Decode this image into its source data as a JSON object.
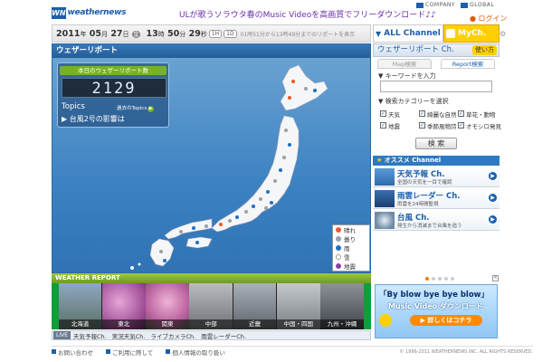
{
  "header": {
    "logo_mark": "WN",
    "logo_text": "weathernews",
    "promo": "ULが歌うソラウタ春のMusic Videoを高画質でフリーダウンロード♪♪",
    "links": [
      "COMPANY",
      "GLOBAL"
    ],
    "login": "ログイン"
  },
  "datebar": {
    "year": "2011",
    "y_unit": "年",
    "month": "05",
    "m_unit": "月",
    "day": "27",
    "d_unit": "日",
    "weekday": "金",
    "hour": "13",
    "h_unit": "時",
    "minute": "50",
    "min_unit": "分",
    "second": "29",
    "s_unit": "秒",
    "btn1": "1H",
    "btn2": "1D",
    "range_note": "01時51分から13時49分までのリポートを表示"
  },
  "channels": {
    "all": "ALL Channel",
    "my": "MyCh."
  },
  "map": {
    "title": "ウェザーリポート",
    "counter_label": "本日のウェザーリポート数",
    "count": "2129",
    "topics": "Topics",
    "past_topics": "過去のTopics",
    "topic_line": "台風2号の影響は",
    "legend": [
      {
        "label": "晴れ",
        "color": "#f05a28"
      },
      {
        "label": "曇り",
        "color": "#9aa0a6"
      },
      {
        "label": "雨",
        "color": "#1f6fc4"
      },
      {
        "label": "雪",
        "color": "#ffffff"
      },
      {
        "label": "地震",
        "color": "#8b3fb2"
      }
    ]
  },
  "weather_report": {
    "title": "WEATHER REPORT",
    "regions": [
      "北海道",
      "東北",
      "関東",
      "中部",
      "近畿",
      "中国・四国",
      "九州・沖縄"
    ]
  },
  "live": {
    "tag": "LIVE",
    "items": [
      "天気予報Ch.",
      "実況天気Ch.",
      "ライブカメラCh.",
      "雨雲レーダーCh."
    ]
  },
  "footer": {
    "links": [
      "お問い合わせ",
      "ご利用に際して",
      "個人情報の取り扱い"
    ],
    "copyright": "© 1996-2011 WEATHERNEWS INC. ALL RIGHTS RESERVED."
  },
  "right_panel": {
    "title": "ウェザーリポート Ch.",
    "use_btn": "使い方",
    "tabs": [
      "Map検索",
      "Report検索"
    ],
    "keyword_label": "▼ キーワードを入力",
    "keyword_value": "",
    "category_label": "▼ 検索カテゴリーを選択",
    "categories": [
      [
        "天気",
        "綺麗な自然",
        "草花・動物"
      ],
      [
        "地震",
        "季節風物詩",
        "オモシロ発見"
      ]
    ],
    "search_btn": "検 索",
    "osusume_star": "★",
    "osusume": "オススメ Channel",
    "channels": [
      {
        "name": "天気予報 Ch.",
        "desc": "全国の天気を一目で確認"
      },
      {
        "name": "雨雲レーダー Ch.",
        "desc": "雨雲を24時間監視"
      },
      {
        "name": "台風 Ch.",
        "desc": "発生から消滅まで台風を追う"
      }
    ],
    "ad": {
      "line1": "「By blow bye bye blow」",
      "line2": "Music Video ダウンロード",
      "cta": "詳しくはコチラ"
    }
  }
}
